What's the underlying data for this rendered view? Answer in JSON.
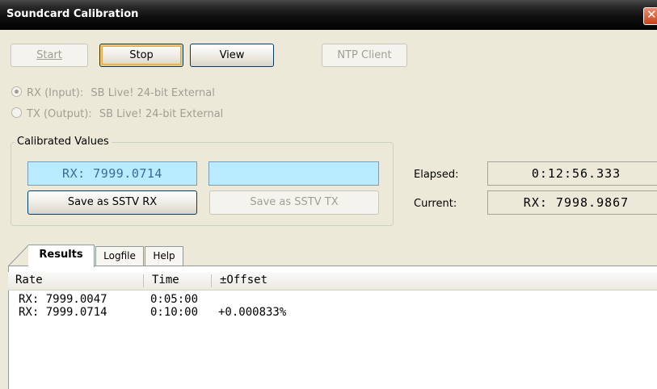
{
  "window": {
    "title": "Soundcard Calibration",
    "close_glyph": "✕"
  },
  "toolbar": {
    "start_label": "Start",
    "stop_label": "Stop",
    "view_label": "View",
    "ntp_label": "NTP Client"
  },
  "devices": {
    "rx": {
      "label": "RX (Input):",
      "device": "SB Live! 24-bit External",
      "selected": true
    },
    "tx": {
      "label": "TX (Output):",
      "device": "SB Live! 24-bit External",
      "selected": false
    }
  },
  "calibrated": {
    "legend": "Calibrated Values",
    "rx_value": "RX: 7999.0714",
    "tx_value": "",
    "save_rx_label": "Save as SSTV RX",
    "save_tx_label": "Save as SSTV TX"
  },
  "status": {
    "elapsed_label": "Elapsed:",
    "elapsed_value": "0:12:56.333",
    "current_label": "Current:",
    "current_value": "RX: 7998.9867"
  },
  "tabs": [
    {
      "label": "Results",
      "active": true
    },
    {
      "label": "Logfile",
      "active": false
    },
    {
      "label": "Help",
      "active": false
    }
  ],
  "results": {
    "columns": [
      "Rate",
      "Time",
      "±Offset"
    ],
    "rows": [
      {
        "rate": "RX: 7999.0047",
        "time": "0:05:00",
        "offset": ""
      },
      {
        "rate": "RX: 7999.0714",
        "time": "0:10:00",
        "offset": "+0.000833%"
      }
    ]
  },
  "colors": {
    "accent_cyan": "#b9ecff",
    "title_bar": "#000000",
    "close_button": "#d2522d"
  }
}
